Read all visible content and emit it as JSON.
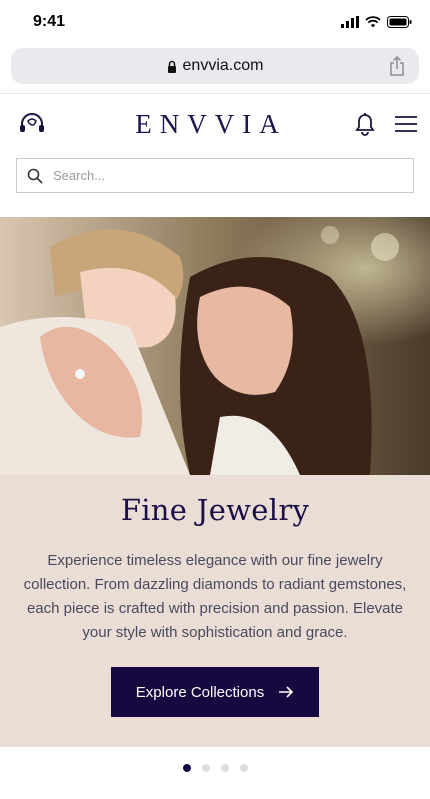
{
  "status": {
    "time": "9:41"
  },
  "browser": {
    "url": "envvia.com"
  },
  "header": {
    "logo": "ENVVIA"
  },
  "search": {
    "placeholder": "Search..."
  },
  "promo": {
    "title": "Fine Jewelry",
    "body": "Experience timeless elegance with our fine jewelry collection. From dazzling diamonds to radiant gemstones, each piece is crafted with precision and passion. Elevate your style with sophistication and grace.",
    "cta": "Explore Collections"
  },
  "carousel": {
    "count": 4,
    "active": 1
  },
  "colors": {
    "accent": "#17093f",
    "promo_bg": "#e9ddd6"
  },
  "icons": [
    "lock-icon",
    "share-icon",
    "support-icon",
    "bell-icon",
    "menu-icon",
    "search-icon",
    "arrow-right-icon"
  ]
}
